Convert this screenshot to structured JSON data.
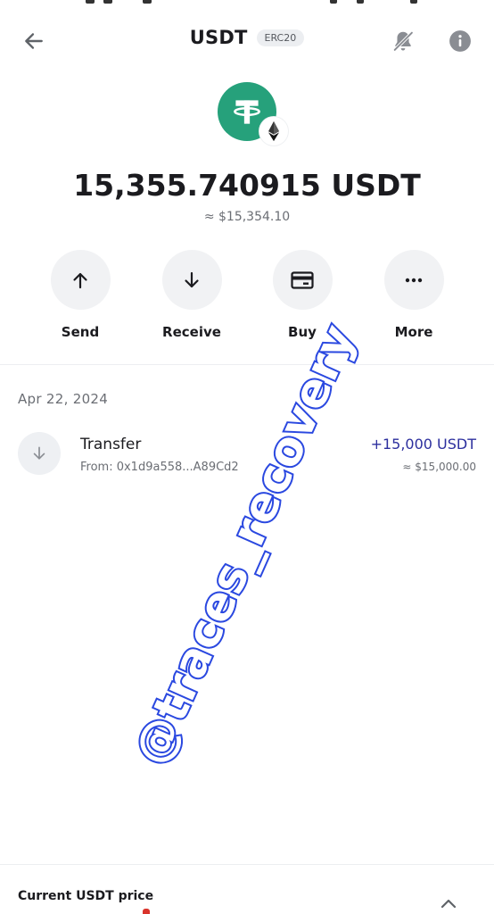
{
  "header": {
    "title": "USDT",
    "network_chip": "ERC20",
    "back_icon": "arrow-left-icon",
    "notifications_icon": "bell-off-icon",
    "info_icon": "info-icon"
  },
  "token": {
    "logo_icon": "tether-icon",
    "network_badge_icon": "ethereum-icon",
    "brand_color": "#26a17b"
  },
  "balance": {
    "amount": "15,355.740915 USDT",
    "fiat": "≈ $15,354.10"
  },
  "actions": [
    {
      "label": "Send",
      "icon": "arrow-up-icon"
    },
    {
      "label": "Receive",
      "icon": "arrow-down-icon"
    },
    {
      "label": "Buy",
      "icon": "card-icon"
    },
    {
      "label": "More",
      "icon": "more-dots-icon"
    }
  ],
  "history": {
    "date": "Apr 22, 2024",
    "transactions": [
      {
        "title": "Transfer",
        "subtitle": "From: 0x1d9a558...A89Cd2",
        "amount": "+15,000 USDT",
        "fiat": "≈ $15,000.00",
        "icon": "arrow-down-icon",
        "amount_color": "#2c2f9e"
      }
    ]
  },
  "watermark": "@traces_recovery",
  "footer": {
    "price_label": "Current USDT price",
    "chevron_icon": "chevron-up-icon"
  }
}
